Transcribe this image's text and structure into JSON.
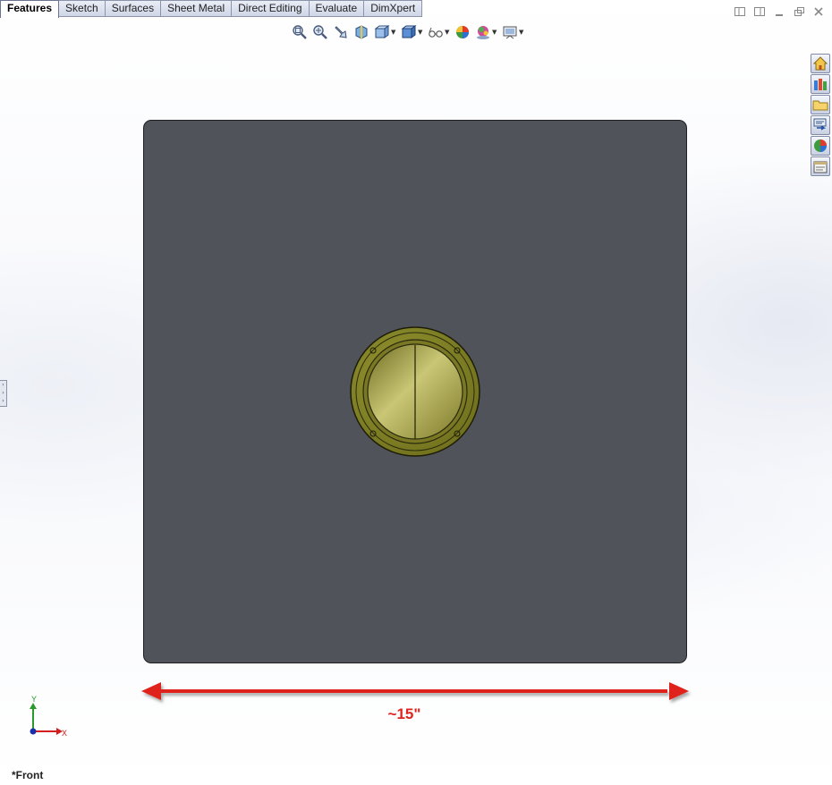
{
  "tabs": [
    {
      "label": "Features",
      "active": true
    },
    {
      "label": "Sketch"
    },
    {
      "label": "Surfaces"
    },
    {
      "label": "Sheet Metal"
    },
    {
      "label": "Direct Editing"
    },
    {
      "label": "Evaluate"
    },
    {
      "label": "DimXpert"
    }
  ],
  "window_controls": [
    "tile-left-icon",
    "tile-right-icon",
    "minimize-icon",
    "restore-icon",
    "close-icon"
  ],
  "heads_up_toolbar": [
    "zoom-to-fit-icon",
    "zoom-to-area-icon",
    "previous-view-icon",
    "section-view-icon",
    "view-orientation-icon",
    "display-style-icon",
    "hide-show-items-icon",
    "edit-appearance-icon",
    "apply-scene-icon",
    "view-settings-icon"
  ],
  "task_pane": [
    "solidworks-resources-icon",
    "design-library-icon",
    "file-explorer-icon",
    "view-palette-icon",
    "appearances-scenes-icon",
    "custom-properties-icon"
  ],
  "dimension": {
    "label": "~15\"",
    "color": "#e0231e"
  },
  "triad": {
    "y_label": "Y",
    "x_label": "X"
  },
  "view_name": "*Front",
  "colors": {
    "plate": "#505359",
    "fitting": "#8a8a2a"
  }
}
